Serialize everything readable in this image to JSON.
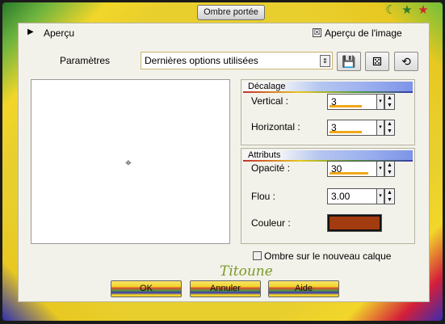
{
  "window": {
    "title": "Ombre portée"
  },
  "header": {
    "apercu_label": "Aperçu",
    "apercu_image_label": "Aperçu de l'image",
    "apercu_image_checked": "☒"
  },
  "params": {
    "label": "Paramètres",
    "preset_value": "Dernières options utilisées"
  },
  "decalage": {
    "title": "Décalage",
    "vertical_label": "Vertical :",
    "vertical_value": "3",
    "horizontal_label": "Horizontal :",
    "horizontal_value": "3"
  },
  "attributs": {
    "title": "Attributs",
    "opacite_label": "Opacité :",
    "opacite_value": "30",
    "flou_label": "Flou :",
    "flou_value": "3.00",
    "couleur_label": "Couleur :",
    "couleur_color": "#a33b10"
  },
  "options": {
    "nouveau_calque_label": "Ombre sur le nouveau calque"
  },
  "signature": "Titoune",
  "buttons": {
    "ok": "OK",
    "cancel": "Annuler",
    "help": "Aide"
  },
  "icons": [
    "moon-icon",
    "star-icon",
    "star-icon",
    "save-preset-icon",
    "dice-icon",
    "reset-icon",
    "crosshair-icon"
  ]
}
